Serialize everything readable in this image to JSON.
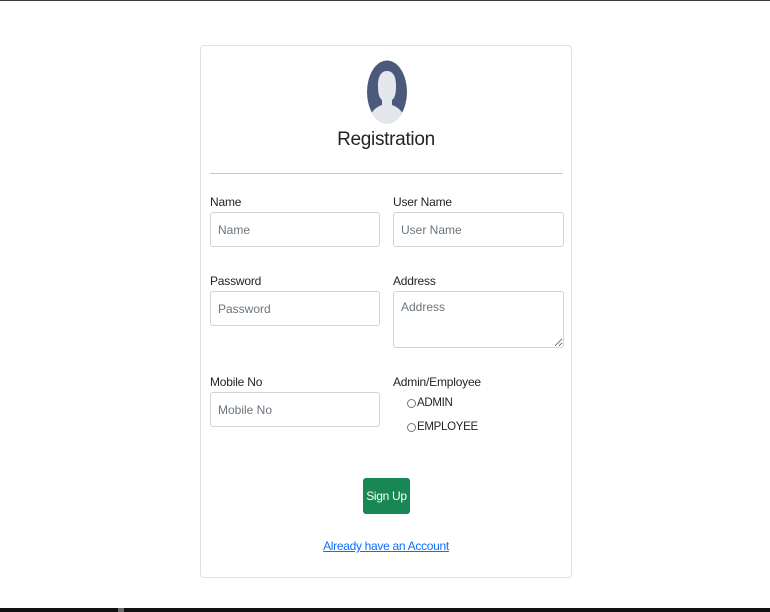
{
  "form": {
    "title": "Registration",
    "fields": {
      "name": {
        "label": "Name",
        "placeholder": "Name",
        "value": ""
      },
      "username": {
        "label": "User Name",
        "placeholder": "User Name",
        "value": ""
      },
      "password": {
        "label": "Password",
        "placeholder": "Password",
        "value": ""
      },
      "address": {
        "label": "Address",
        "placeholder": "Address",
        "value": ""
      },
      "mobile": {
        "label": "Mobile No",
        "placeholder": "Mobile No",
        "value": ""
      }
    },
    "role": {
      "label": "Admin/Employee",
      "options": [
        {
          "label": "ADMIN",
          "checked": false
        },
        {
          "label": "EMPLOYEE",
          "checked": false
        }
      ]
    },
    "submit_label": "Sign Up",
    "login_link": "Already have an Account"
  },
  "icons": {
    "avatar": "user-avatar-icon"
  },
  "colors": {
    "accent_green": "#198754",
    "link_blue": "#0d6efd",
    "avatar_dark": "#4b5a7a",
    "avatar_light": "#e4e7ec"
  }
}
